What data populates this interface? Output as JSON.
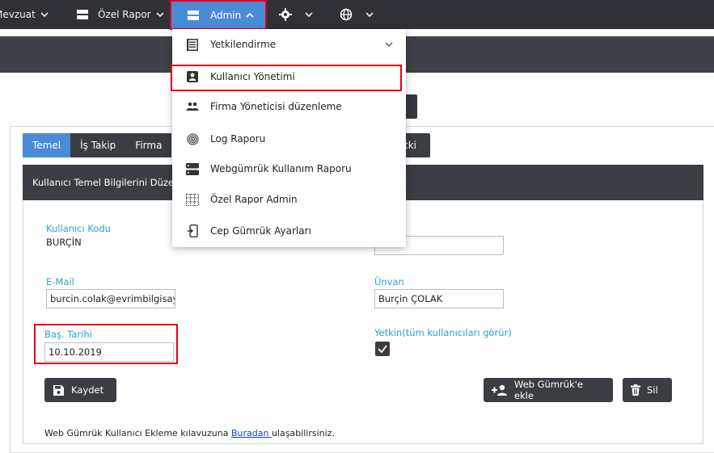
{
  "navbar": {
    "items": [
      {
        "label": "Mevzuat",
        "icon": "chevron-down-icon"
      },
      {
        "label": "Özel Rapor",
        "icon": "report-icon"
      },
      {
        "label": "Admin",
        "icon": "admin-panel-icon"
      },
      {
        "label": "",
        "icon": "gear-icon"
      },
      {
        "label": "",
        "icon": "globe-icon"
      }
    ]
  },
  "dropdown": {
    "items": [
      {
        "label": "Yetkilendirme",
        "icon": "document-list-icon",
        "has_submenu": true
      },
      {
        "label": "Kullanıcı Yönetimi",
        "icon": "user-badge-icon"
      },
      {
        "label": "Firma Yöneticisi düzenleme",
        "icon": "users-icon"
      },
      {
        "label": "Log Raporu",
        "icon": "fingerprint-icon"
      },
      {
        "label": "Webgümrük Kullanım Raporu",
        "icon": "server-icon"
      },
      {
        "label": "Özel Rapor Admin",
        "icon": "table-grid-icon"
      },
      {
        "label": "Cep Gümrük Ayarları",
        "icon": "mobile-icon"
      }
    ]
  },
  "tabs": [
    {
      "label": "Temel",
      "active": true
    },
    {
      "label": "İş Takip",
      "active": false
    },
    {
      "label": "Firma",
      "active": false
    },
    {
      "label": "tki",
      "active": false
    }
  ],
  "card": {
    "header": "Kullanıcı Temel Bilgilerini Düze"
  },
  "form": {
    "kullanici_kodu": {
      "label": "Kullanıcı Kodu",
      "value": "BURÇİN"
    },
    "email": {
      "label": "E-Mail",
      "value": "burcin.colak@evrimbilgisay"
    },
    "unvan": {
      "label": "Ünvan",
      "value": "Burçin ÇOLAK"
    },
    "bas_tarihi": {
      "label": "Baş. Tarihi",
      "value": "10.10.2019"
    },
    "yetkin": {
      "label": "Yetkin(tüm kullanıcıları görür)",
      "checked": true
    },
    "right_top_value": ""
  },
  "buttons": {
    "save": "Kaydet",
    "web_gumruk": "Web Gümrük'e ekle",
    "delete": "Sil"
  },
  "footer": {
    "prefix": "Web Gümrük Kullanıcı Ekleme kılavuzuna ",
    "link": "Buradan ",
    "suffix": "ulaşabilirsiniz."
  },
  "colors": {
    "navbar": "#2f3136",
    "accent": "#4a8bd6",
    "label_blue": "#2a9fd8",
    "highlight": "#e0001b"
  }
}
